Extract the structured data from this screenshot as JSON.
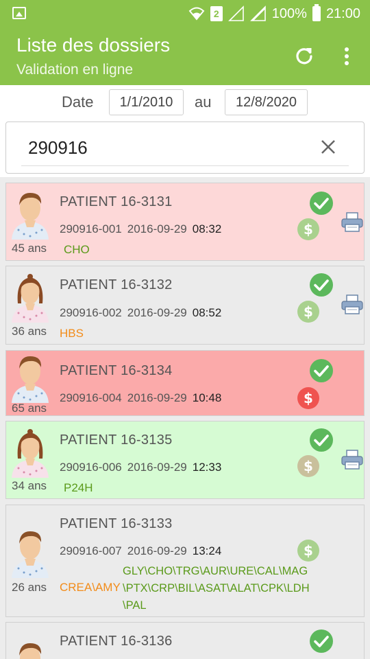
{
  "status_bar": {
    "battery": "100%",
    "time": "21:00",
    "sim": "2"
  },
  "app_bar": {
    "title": "Liste des dossiers",
    "subtitle": "Validation en ligne"
  },
  "date_filter": {
    "label_from": "Date",
    "from": "1/1/2010",
    "label_to": "au",
    "to": "12/8/2020"
  },
  "search": {
    "value": "290916"
  },
  "patients": [
    {
      "name": "PATIENT 16-3131",
      "age": "45 ans",
      "sample": "290916-001",
      "date": "2016-09-29",
      "time": "08:32",
      "tests": "CHO",
      "gender": "male",
      "bg": "#fdd8d8",
      "validated": true,
      "billing": "paid",
      "printable": true
    },
    {
      "name": "PATIENT 16-3132",
      "age": "36 ans",
      "sample": "290916-002",
      "date": "2016-09-29",
      "time": "08:52",
      "tests": "HBS",
      "gender": "female",
      "bg": "#ebebeb",
      "validated": true,
      "billing": "paid",
      "printable": true
    },
    {
      "name": "PATIENT 16-3134",
      "age": "65 ans",
      "sample": "290916-004",
      "date": "2016-09-29",
      "time": "10:48",
      "tests": "",
      "gender": "male",
      "bg": "#fbaaaa",
      "validated": true,
      "billing": "unpaid",
      "printable": false
    },
    {
      "name": "PATIENT 16-3135",
      "age": "34 ans",
      "sample": "290916-006",
      "date": "2016-09-29",
      "time": "12:33",
      "tests": "P24H",
      "gender": "female",
      "bg": "#d6fbd3",
      "validated": true,
      "billing": "paid",
      "printable": true
    },
    {
      "name": "PATIENT 16-3133",
      "age": "26 ans",
      "sample": "290916-007",
      "date": "2016-09-29",
      "time": "13:24",
      "tests_orange": "CREA\\AMY",
      "tests_green": [
        "GLY\\CHO\\TRG\\AUR\\URE\\CAL\\MAG",
        "\\PTX\\CRP\\BIL\\ASAT\\ALAT\\CPK\\LDH",
        "\\PAL"
      ],
      "gender": "male",
      "bg": "#ebebeb",
      "validated": false,
      "billing": "paid",
      "printable": false
    },
    {
      "name": "PATIENT 16-3136",
      "gender": "male",
      "bg": "#ebebeb",
      "validated": true
    }
  ],
  "colors": {
    "accent": "#8bc34a",
    "check_green": "#5cb85c",
    "dollar_paid": "#a9d18e",
    "dollar_unpaid": "#ef5350",
    "test_green": "#5a9a1a",
    "test_orange": "#f28c1a"
  }
}
